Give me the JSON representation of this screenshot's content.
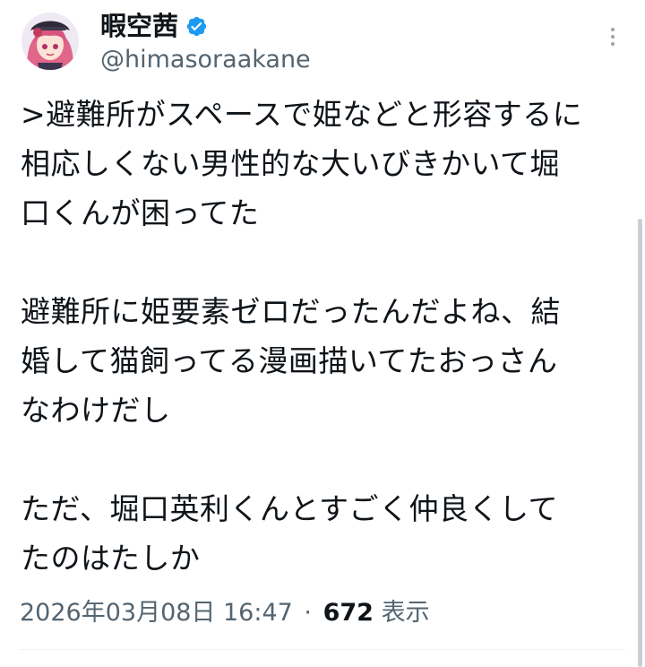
{
  "author": {
    "display_name": "暇空茜",
    "handle": "@himasoraakane",
    "verified_icon": "verified-badge-icon",
    "avatar_icon": "anime-girl-avatar"
  },
  "tweet": {
    "paragraphs": [
      [
        ">避難所がスペースで姫などと形容するに",
        "相応しくない男性的な大いびきかいて堀",
        "口くんが困ってた"
      ],
      [
        "避難所に姫要素ゼロだったんだよね、結",
        "婚して猫飼ってる漫画描いてたおっさん",
        "なわけだし"
      ],
      [
        "ただ、堀口英利くんとすごく仲良くして",
        "たのはたしか"
      ]
    ]
  },
  "meta": {
    "timestamp": "2026年03月08日 16:47",
    "separator": "·",
    "views_count": "672",
    "views_label": "表示"
  },
  "colors": {
    "text": "#0f1419",
    "secondary": "#536471",
    "verified": "#1d9bf0",
    "divider": "#eff3f4"
  }
}
